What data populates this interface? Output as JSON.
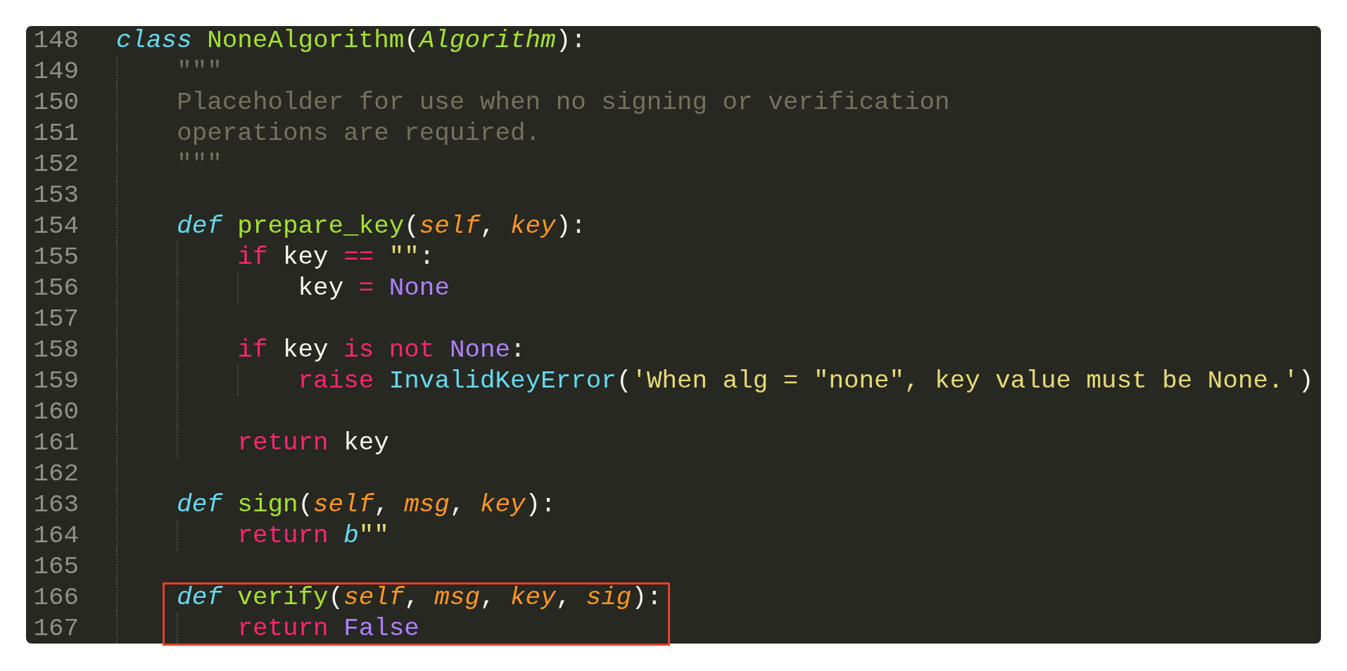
{
  "editor": {
    "lines": [
      {
        "number": "148",
        "highlighted": false,
        "tokens": [
          {
            "kind": "storage",
            "text": "class "
          },
          {
            "kind": "name",
            "text": "NoneAlgorithm"
          },
          {
            "kind": "plain",
            "text": "("
          },
          {
            "kind": "inherited",
            "text": "Algorithm"
          },
          {
            "kind": "plain",
            "text": "):"
          }
        ],
        "children": [
          {
            "number": "149",
            "highlighted": false,
            "tokens": [
              {
                "kind": "comment",
                "text": "\"\"\""
              }
            ]
          },
          {
            "number": "150",
            "highlighted": false,
            "tokens": [
              {
                "kind": "comment",
                "text": "Placeholder for use when no signing or verification"
              }
            ]
          },
          {
            "number": "151",
            "highlighted": false,
            "tokens": [
              {
                "kind": "comment",
                "text": "operations are required."
              }
            ]
          },
          {
            "number": "152",
            "highlighted": false,
            "tokens": [
              {
                "kind": "comment",
                "text": "\"\"\""
              }
            ]
          },
          {
            "number": "153",
            "highlighted": false
          },
          {
            "number": "154",
            "highlighted": false,
            "tokens": [
              {
                "kind": "storage",
                "text": "def "
              },
              {
                "kind": "name",
                "text": "prepare_key"
              },
              {
                "kind": "plain",
                "text": "("
              },
              {
                "kind": "param",
                "text": "self"
              },
              {
                "kind": "plain",
                "text": ", "
              },
              {
                "kind": "param",
                "text": "key"
              },
              {
                "kind": "plain",
                "text": "):"
              }
            ],
            "children": [
              {
                "number": "155",
                "highlighted": false,
                "tokens": [
                  {
                    "kind": "keyword",
                    "text": "if"
                  },
                  {
                    "kind": "plain",
                    "text": " key "
                  },
                  {
                    "kind": "keyword",
                    "text": "== "
                  },
                  {
                    "kind": "string",
                    "text": "\"\""
                  },
                  {
                    "kind": "plain",
                    "text": ":"
                  }
                ],
                "children": [
                  {
                    "number": "156",
                    "highlighted": false,
                    "tokens": [
                      {
                        "kind": "plain",
                        "text": "key "
                      },
                      {
                        "kind": "keyword",
                        "text": "= "
                      },
                      {
                        "kind": "constant",
                        "text": "None"
                      }
                    ]
                  }
                ]
              },
              {
                "number": "157",
                "highlighted": false
              },
              {
                "number": "158",
                "highlighted": false,
                "tokens": [
                  {
                    "kind": "keyword",
                    "text": "if"
                  },
                  {
                    "kind": "plain",
                    "text": " key "
                  },
                  {
                    "kind": "keyword",
                    "text": "is not "
                  },
                  {
                    "kind": "constant",
                    "text": "None"
                  },
                  {
                    "kind": "plain",
                    "text": ":"
                  }
                ],
                "children": [
                  {
                    "number": "159",
                    "highlighted": false,
                    "tokens": [
                      {
                        "kind": "keyword",
                        "text": "raise "
                      },
                      {
                        "kind": "support",
                        "text": "InvalidKeyError"
                      },
                      {
                        "kind": "plain",
                        "text": "("
                      },
                      {
                        "kind": "string",
                        "text": "'When alg = \"none\", key value must be None.'"
                      },
                      {
                        "kind": "plain",
                        "text": ")"
                      }
                    ]
                  }
                ]
              },
              {
                "number": "160",
                "highlighted": false
              },
              {
                "number": "161",
                "highlighted": false,
                "tokens": [
                  {
                    "kind": "keyword",
                    "text": "return"
                  },
                  {
                    "kind": "plain",
                    "text": " key"
                  }
                ]
              }
            ]
          },
          {
            "number": "162",
            "highlighted": false
          },
          {
            "number": "163",
            "highlighted": false,
            "tokens": [
              {
                "kind": "storage",
                "text": "def "
              },
              {
                "kind": "name",
                "text": "sign"
              },
              {
                "kind": "plain",
                "text": "("
              },
              {
                "kind": "param",
                "text": "self"
              },
              {
                "kind": "plain",
                "text": ", "
              },
              {
                "kind": "param",
                "text": "msg"
              },
              {
                "kind": "plain",
                "text": ", "
              },
              {
                "kind": "param",
                "text": "key"
              },
              {
                "kind": "plain",
                "text": "):"
              }
            ],
            "children": [
              {
                "number": "164",
                "highlighted": false,
                "tokens": [
                  {
                    "kind": "keyword",
                    "text": "return "
                  },
                  {
                    "kind": "storage",
                    "text": "b"
                  },
                  {
                    "kind": "string",
                    "text": "\"\""
                  }
                ]
              }
            ]
          },
          {
            "number": "165",
            "highlighted": false
          },
          {
            "number": "166",
            "highlighted": true,
            "tokens": [
              {
                "kind": "storage",
                "text": "def "
              },
              {
                "kind": "name",
                "text": "verify"
              },
              {
                "kind": "plain",
                "text": "("
              },
              {
                "kind": "param",
                "text": "self"
              },
              {
                "kind": "plain",
                "text": ", "
              },
              {
                "kind": "param",
                "text": "msg"
              },
              {
                "kind": "plain",
                "text": ", "
              },
              {
                "kind": "param",
                "text": "key"
              },
              {
                "kind": "plain",
                "text": ", "
              },
              {
                "kind": "param",
                "text": "sig"
              },
              {
                "kind": "plain",
                "text": "):"
              }
            ],
            "children": [
              {
                "number": "167",
                "highlighted": true,
                "tokens": [
                  {
                    "kind": "keyword",
                    "text": "return "
                  },
                  {
                    "kind": "constant",
                    "text": "False"
                  }
                ]
              }
            ]
          }
        ]
      }
    ]
  }
}
